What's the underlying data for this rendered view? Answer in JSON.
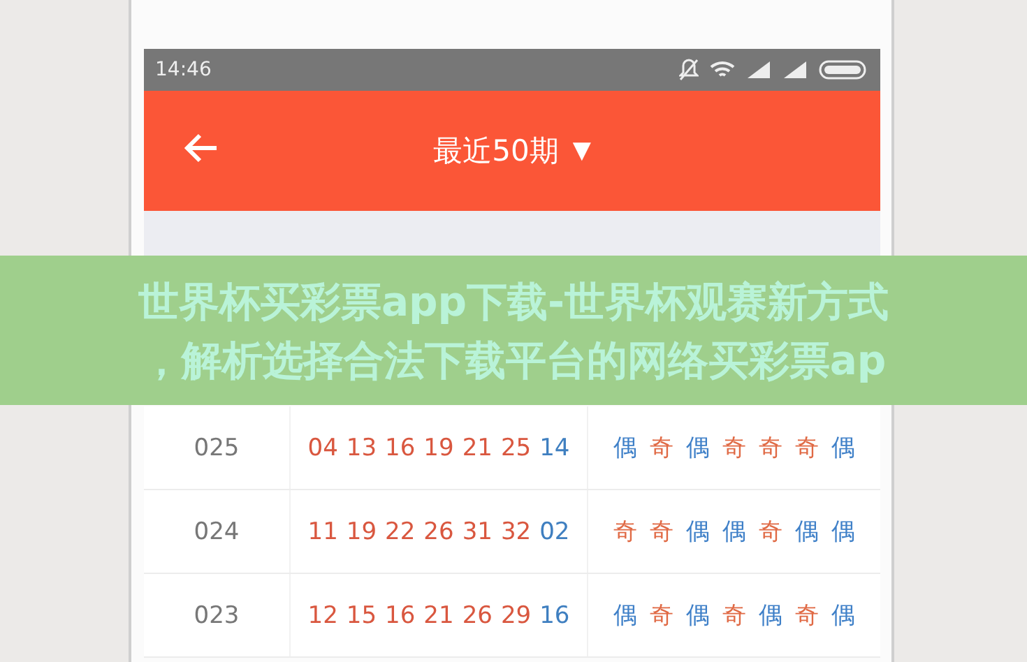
{
  "status_bar": {
    "time": "14:46"
  },
  "header": {
    "title": "最近50期",
    "dropdown": "▼"
  },
  "banner": {
    "lines": [
      "世界杯买彩票app下载-世界杯观赛新方式",
      "，解析选择合法下载平台的网络买彩票ap"
    ]
  },
  "rows": [
    {
      "issue": "025",
      "numbers": [
        {
          "text": "04",
          "kind": "red"
        },
        {
          "text": "13",
          "kind": "red"
        },
        {
          "text": "16",
          "kind": "red"
        },
        {
          "text": "19",
          "kind": "red"
        },
        {
          "text": "21",
          "kind": "red"
        },
        {
          "text": "25",
          "kind": "red"
        },
        {
          "text": "14",
          "kind": "blue"
        }
      ],
      "parity": [
        {
          "text": "偶",
          "kind": "even"
        },
        {
          "text": "奇",
          "kind": "odd"
        },
        {
          "text": "偶",
          "kind": "even"
        },
        {
          "text": "奇",
          "kind": "odd"
        },
        {
          "text": "奇",
          "kind": "odd"
        },
        {
          "text": "奇",
          "kind": "odd"
        },
        {
          "text": "偶",
          "kind": "even"
        }
      ]
    },
    {
      "issue": "024",
      "numbers": [
        {
          "text": "11",
          "kind": "red"
        },
        {
          "text": "19",
          "kind": "red"
        },
        {
          "text": "22",
          "kind": "red"
        },
        {
          "text": "26",
          "kind": "red"
        },
        {
          "text": "31",
          "kind": "red"
        },
        {
          "text": "32",
          "kind": "red"
        },
        {
          "text": "02",
          "kind": "blue"
        }
      ],
      "parity": [
        {
          "text": "奇",
          "kind": "odd"
        },
        {
          "text": "奇",
          "kind": "odd"
        },
        {
          "text": "偶",
          "kind": "even"
        },
        {
          "text": "偶",
          "kind": "even"
        },
        {
          "text": "奇",
          "kind": "odd"
        },
        {
          "text": "偶",
          "kind": "even"
        },
        {
          "text": "偶",
          "kind": "even"
        }
      ]
    },
    {
      "issue": "023",
      "numbers": [
        {
          "text": "12",
          "kind": "red"
        },
        {
          "text": "15",
          "kind": "red"
        },
        {
          "text": "16",
          "kind": "red"
        },
        {
          "text": "21",
          "kind": "red"
        },
        {
          "text": "26",
          "kind": "red"
        },
        {
          "text": "29",
          "kind": "red"
        },
        {
          "text": "16",
          "kind": "blue"
        }
      ],
      "parity": [
        {
          "text": "偶",
          "kind": "even"
        },
        {
          "text": "奇",
          "kind": "odd"
        },
        {
          "text": "偶",
          "kind": "even"
        },
        {
          "text": "奇",
          "kind": "odd"
        },
        {
          "text": "偶",
          "kind": "even"
        },
        {
          "text": "奇",
          "kind": "odd"
        },
        {
          "text": "偶",
          "kind": "even"
        }
      ]
    }
  ]
}
